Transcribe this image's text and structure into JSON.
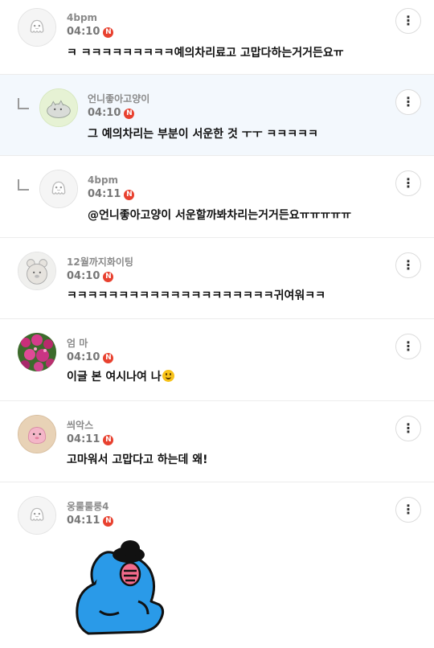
{
  "more_icon_glyph": "⋮",
  "badge_new": "N",
  "colors": {
    "badge": "#e8412f",
    "highlight_row": "#f3f8fd",
    "sticker_body": "#2a9ae8"
  },
  "comments": [
    {
      "nickname": "4bpm",
      "time": "04:10",
      "text": "ㅋ ㅋㅋㅋㅋㅋㅋㅋㅋㅋ예의차리료고 고맙다하는거거든요ㅠ",
      "reply": false,
      "avatar": "default-ghost-avatar"
    },
    {
      "nickname": "언니좋아고양이",
      "time": "04:10",
      "text": "그 예의차리는 부분이 서운한 것 ㅜㅜ ㅋㅋㅋㅋㅋ",
      "reply": true,
      "avatar": "cat-avatar"
    },
    {
      "nickname": "4bpm",
      "time": "04:11",
      "text": "@언니좋아고양이 서운할까봐차리는거거든요ㅠㅠㅠㅠㅠ",
      "reply": true,
      "avatar": "default-ghost-avatar"
    },
    {
      "nickname": "12월까지화이팅",
      "time": "04:10",
      "text": "ㅋㅋㅋㅋㅋㅋㅋㅋㅋㅋㅋㅋㅋㅋㅋㅋㅋㅋㅋㅋ귀여워ㅋㅋ",
      "reply": false,
      "avatar": "bear-avatar"
    },
    {
      "nickname": "엄 마",
      "time": "04:10",
      "text": "이글 본 여시나여 나",
      "reply": false,
      "avatar": "flower-photo-avatar",
      "emoji": "smile-emoji"
    },
    {
      "nickname": "씌악스",
      "time": "04:11",
      "text": "고마워서 고맙다고 하는데 왜!",
      "reply": false,
      "avatar": "pink-character-avatar"
    },
    {
      "nickname": "웅룰룰룽4",
      "time": "04:11",
      "text": "",
      "reply": false,
      "avatar": "default-ghost-avatar",
      "sticker": "blue-character-sticker"
    }
  ]
}
